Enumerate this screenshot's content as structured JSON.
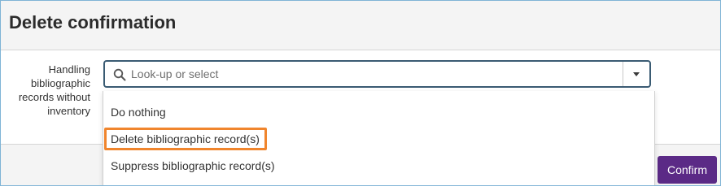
{
  "dialog": {
    "title": "Delete confirmation"
  },
  "form": {
    "field_label": "Handling bibliographic records without inventory",
    "select": {
      "placeholder": "Look-up or select",
      "value": "",
      "search_icon": "search-icon",
      "toggle_icon": "chevron-down-icon",
      "options": [
        {
          "label": "Do nothing"
        },
        {
          "label": "Delete bibliographic record(s)",
          "highlighted": true
        },
        {
          "label": "Suppress bibliographic record(s)"
        }
      ]
    }
  },
  "footer": {
    "confirm_label": "Confirm"
  },
  "colors": {
    "accent": "#5b2a86",
    "highlight": "#f0852d",
    "focus_border": "#3a5b73",
    "frame_border": "#7fb4d6"
  }
}
